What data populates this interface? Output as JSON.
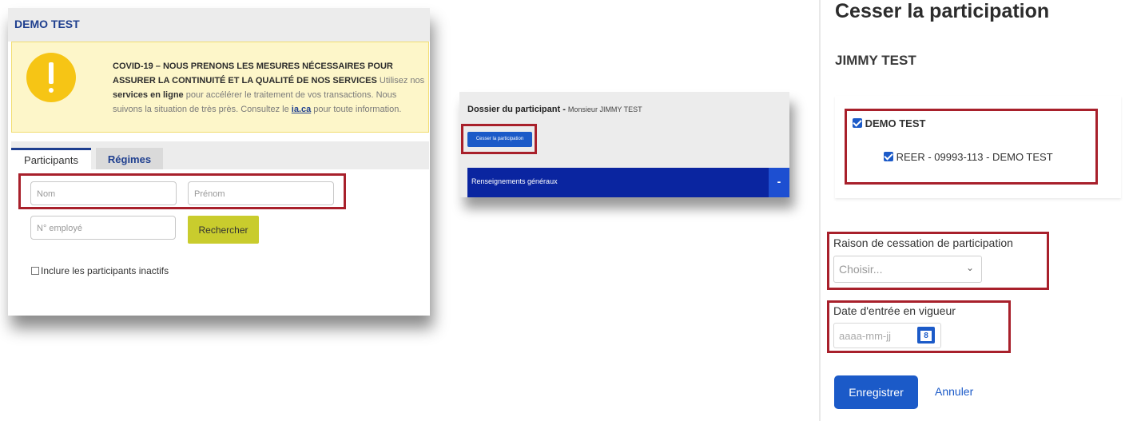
{
  "search_panel": {
    "title": "DEMO TEST",
    "alert": {
      "heading": "COVID-19 – NOUS PRENONS LES MESURES NÉCESSAIRES POUR ASSURER LA CONTINUITÉ ET LA QUALITÉ DE NOS SERVICES",
      "text_1": " Utilisez nos ",
      "link_services": "services en ligne",
      "text_2": " pour accélérer le traitement de vos transactions. Nous suivons la situation de très près. Consultez le ",
      "link_site": "ia.ca",
      "text_3": " pour toute information.",
      "icon": "exclamation-icon",
      "color": "#f6c515"
    },
    "tabs": [
      "Participants",
      "Régimes"
    ],
    "nom_placeholder": "Nom",
    "prenom_placeholder": "Prénom",
    "employe_placeholder": "N° employé",
    "search_button": "Rechercher",
    "include_inactive": "Inclure les participants inactifs"
  },
  "dossier_panel": {
    "title": "Dossier du participant",
    "separator": " - ",
    "subtitle": "Monsieur JIMMY TEST",
    "cesser_button": "Cesser la participation",
    "section": "Renseignements généraux",
    "section_toggle": "-"
  },
  "cessation_panel": {
    "title": "Cesser la participation",
    "participant_name": "JIMMY TEST",
    "tree_root": "DEMO TEST",
    "tree_child": "REER - 09993-113 - DEMO TEST",
    "reason_label": "Raison de cessation de participation",
    "reason_value": "Choisir...",
    "date_label": "Date d'entrée en vigueur",
    "date_placeholder": "aaaa-mm-jj",
    "calendar_day": "8",
    "save_button": "Enregistrer",
    "cancel_button": "Annuler"
  },
  "colors": {
    "brand_blue": "#1b5ac8",
    "dark_blue": "#0a25a0",
    "highlight_red": "#a8202b",
    "search_button": "#c9cc2d"
  }
}
